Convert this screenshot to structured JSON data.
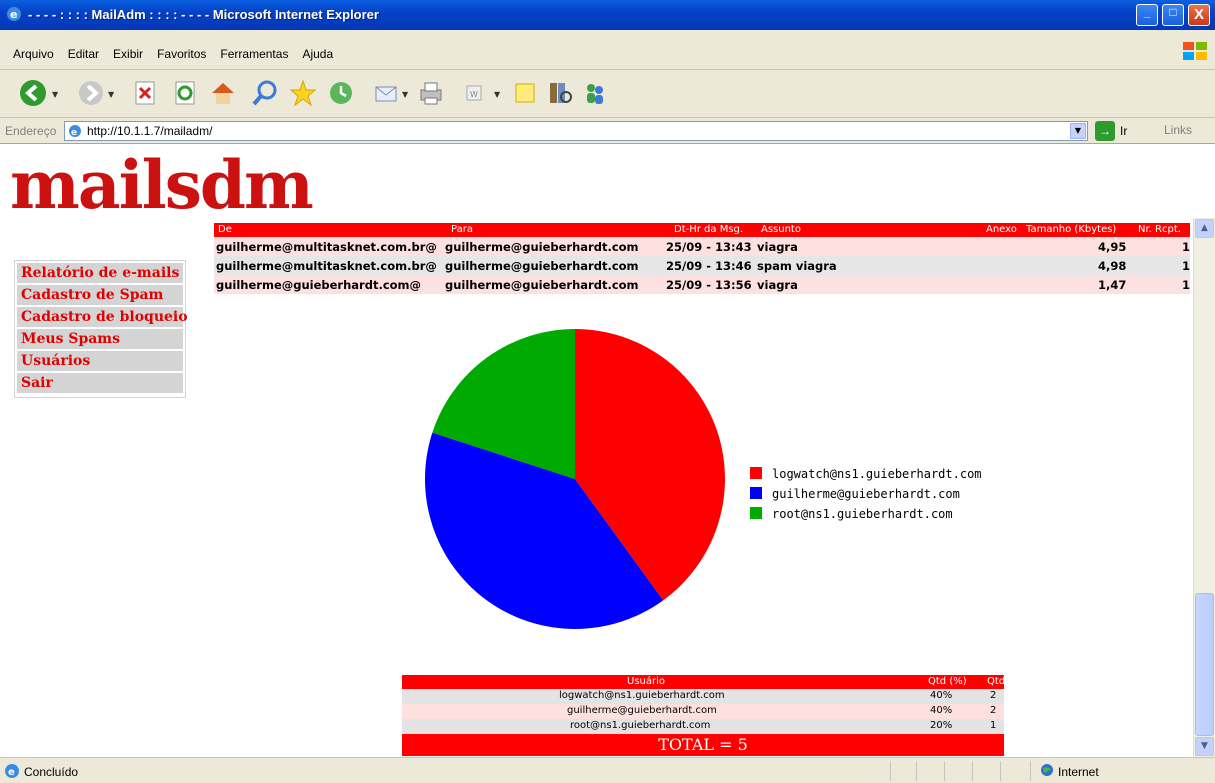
{
  "window": {
    "title": "- - - - : : : : MailAdm : : : : - - - - Microsoft Internet Explorer",
    "min": "_",
    "max": "□",
    "close": "X"
  },
  "menu": [
    "Arquivo",
    "Editar",
    "Exibir",
    "Favoritos",
    "Ferramentas",
    "Ajuda"
  ],
  "toolbar": [
    "back-icon",
    "forward-icon",
    "stop-icon",
    "refresh-icon",
    "home-icon",
    "search-icon",
    "favorites-icon",
    "history-icon",
    "mail-icon",
    "print-icon",
    "edit-icon",
    "discuss-icon",
    "research-icon",
    "messenger-icon"
  ],
  "address": {
    "label": "Endereço",
    "url": "http://10.1.1.7/mailadm/",
    "go": "Ir",
    "links": "Links"
  },
  "logo": "mailsdm",
  "emails": {
    "headers": {
      "de": "De",
      "para": "Para",
      "dt": "Dt-Hr da Msg.",
      "assunto": "Assunto",
      "anexo": "Anexo",
      "tamanho": "Tamanho (Kbytes)",
      "rcpt": "Nr. Rcpt."
    },
    "rows": [
      {
        "de": "guilherme@multitasknet.com.br@",
        "para": "guilherme@guieberhardt.com",
        "dt": "25/09 - 13:43",
        "assunto": "viagra",
        "tamanho": "4,95",
        "rcpt": "1"
      },
      {
        "de": "guilherme@multitasknet.com.br@",
        "para": "guilherme@guieberhardt.com",
        "dt": "25/09 - 13:46",
        "assunto": "spam viagra",
        "tamanho": "4,98",
        "rcpt": "1"
      },
      {
        "de": "guilherme@guieberhardt.com@",
        "para": "guilherme@guieberhardt.com",
        "dt": "25/09 - 13:56",
        "assunto": "viagra",
        "tamanho": "1,47",
        "rcpt": "1"
      }
    ]
  },
  "sidemenu": [
    "Relatório de e-mails",
    "Cadastro de Spam",
    "Cadastro de bloqueio",
    "Meus Spams",
    "Usuários",
    "Sair"
  ],
  "chart_data": {
    "type": "pie",
    "categories": [
      "logwatch@ns1.guieberhardt.com",
      "guilherme@guieberhardt.com",
      "root@ns1.guieberhardt.com"
    ],
    "values": [
      40,
      40,
      20
    ],
    "colors": [
      "#ff0000",
      "#0000ff",
      "#00aa00"
    ],
    "legend": "right"
  },
  "summary": {
    "headers": {
      "usuario": "Usuário",
      "pct": "Qtd (%)",
      "qtd": "Qtd"
    },
    "rows": [
      {
        "usuario": "logwatch@ns1.guieberhardt.com",
        "pct": "40%",
        "qtd": "2"
      },
      {
        "usuario": "guilherme@guieberhardt.com",
        "pct": "40%",
        "qtd": "2"
      },
      {
        "usuario": "root@ns1.guieberhardt.com",
        "pct": "20%",
        "qtd": "1"
      }
    ],
    "total": "TOTAL = 5"
  },
  "status": {
    "text": "Concluído",
    "zone": "Internet"
  }
}
